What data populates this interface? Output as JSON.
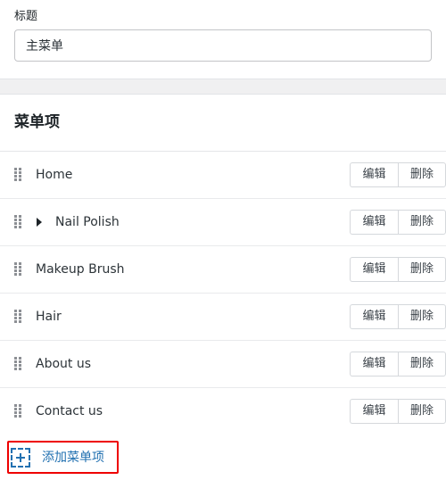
{
  "title_field": {
    "label": "标题",
    "value": "主菜单",
    "placeholder": "主菜单"
  },
  "menu_card": {
    "header": "菜单项",
    "row_actions": {
      "edit_label": "编辑",
      "delete_label": "删除"
    },
    "items": [
      {
        "label": "Home",
        "expandable": false
      },
      {
        "label": "Nail Polish",
        "expandable": true
      },
      {
        "label": "Makeup Brush",
        "expandable": false
      },
      {
        "label": "Hair",
        "expandable": false
      },
      {
        "label": "About us",
        "expandable": false
      },
      {
        "label": "Contact us",
        "expandable": false
      }
    ]
  },
  "add_item": {
    "label": "添加菜单项",
    "icon": "plus-dashed-box-icon"
  },
  "colors": {
    "page_background": "#f0f0f1",
    "card_background": "#ffffff",
    "link_blue": "#2271b1",
    "highlight_red": "#ee0000",
    "text": "#2c3338",
    "border": "#e2e4e7"
  }
}
